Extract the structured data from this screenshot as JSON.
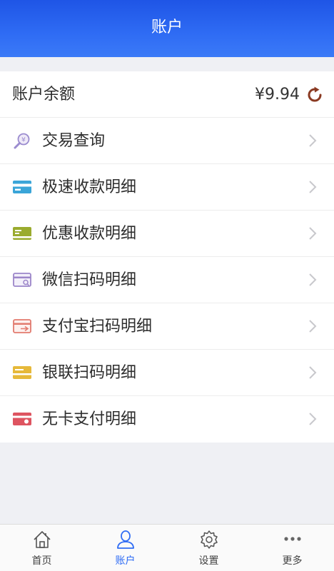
{
  "header": {
    "title": "账户"
  },
  "balance": {
    "label": "账户余额",
    "amount": "¥9.94"
  },
  "menu": [
    {
      "label": "交易查询",
      "icon": "search-coin-icon",
      "color": "#9b8ccf"
    },
    {
      "label": "极速收款明细",
      "icon": "card-blue-icon",
      "color": "#3aa5d8"
    },
    {
      "label": "优惠收款明细",
      "icon": "card-olive-icon",
      "color": "#9aab2e"
    },
    {
      "label": "微信扫码明细",
      "icon": "card-purple-icon",
      "color": "#9c86c9"
    },
    {
      "label": "支付宝扫码明细",
      "icon": "card-red-icon",
      "color": "#e27b6f"
    },
    {
      "label": "银联扫码明细",
      "icon": "card-yellow-icon",
      "color": "#e6b93a"
    },
    {
      "label": "无卡支付明细",
      "icon": "card-crimson-icon",
      "color": "#de5460"
    }
  ],
  "tabs": [
    {
      "label": "首页",
      "icon": "home-icon",
      "active": false
    },
    {
      "label": "账户",
      "icon": "user-icon",
      "active": true
    },
    {
      "label": "设置",
      "icon": "gear-icon",
      "active": false
    },
    {
      "label": "更多",
      "icon": "more-icon",
      "active": false
    }
  ],
  "colors": {
    "accent": "#2f6cf4",
    "refresh": "#8a3a22"
  }
}
